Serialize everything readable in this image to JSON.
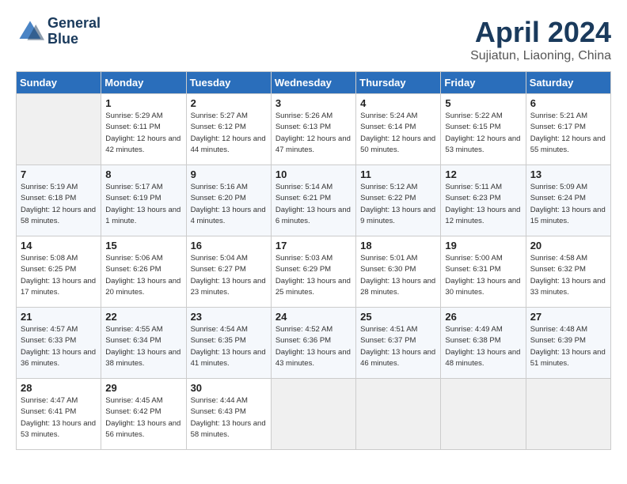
{
  "header": {
    "logo_line1": "General",
    "logo_line2": "Blue",
    "month_year": "April 2024",
    "location": "Sujiatun, Liaoning, China"
  },
  "weekdays": [
    "Sunday",
    "Monday",
    "Tuesday",
    "Wednesday",
    "Thursday",
    "Friday",
    "Saturday"
  ],
  "weeks": [
    [
      {
        "day": "",
        "sunrise": "",
        "sunset": "",
        "daylight": ""
      },
      {
        "day": "1",
        "sunrise": "5:29 AM",
        "sunset": "6:11 PM",
        "daylight": "12 hours and 42 minutes."
      },
      {
        "day": "2",
        "sunrise": "5:27 AM",
        "sunset": "6:12 PM",
        "daylight": "12 hours and 44 minutes."
      },
      {
        "day": "3",
        "sunrise": "5:26 AM",
        "sunset": "6:13 PM",
        "daylight": "12 hours and 47 minutes."
      },
      {
        "day": "4",
        "sunrise": "5:24 AM",
        "sunset": "6:14 PM",
        "daylight": "12 hours and 50 minutes."
      },
      {
        "day": "5",
        "sunrise": "5:22 AM",
        "sunset": "6:15 PM",
        "daylight": "12 hours and 53 minutes."
      },
      {
        "day": "6",
        "sunrise": "5:21 AM",
        "sunset": "6:17 PM",
        "daylight": "12 hours and 55 minutes."
      }
    ],
    [
      {
        "day": "7",
        "sunrise": "5:19 AM",
        "sunset": "6:18 PM",
        "daylight": "12 hours and 58 minutes."
      },
      {
        "day": "8",
        "sunrise": "5:17 AM",
        "sunset": "6:19 PM",
        "daylight": "13 hours and 1 minute."
      },
      {
        "day": "9",
        "sunrise": "5:16 AM",
        "sunset": "6:20 PM",
        "daylight": "13 hours and 4 minutes."
      },
      {
        "day": "10",
        "sunrise": "5:14 AM",
        "sunset": "6:21 PM",
        "daylight": "13 hours and 6 minutes."
      },
      {
        "day": "11",
        "sunrise": "5:12 AM",
        "sunset": "6:22 PM",
        "daylight": "13 hours and 9 minutes."
      },
      {
        "day": "12",
        "sunrise": "5:11 AM",
        "sunset": "6:23 PM",
        "daylight": "13 hours and 12 minutes."
      },
      {
        "day": "13",
        "sunrise": "5:09 AM",
        "sunset": "6:24 PM",
        "daylight": "13 hours and 15 minutes."
      }
    ],
    [
      {
        "day": "14",
        "sunrise": "5:08 AM",
        "sunset": "6:25 PM",
        "daylight": "13 hours and 17 minutes."
      },
      {
        "day": "15",
        "sunrise": "5:06 AM",
        "sunset": "6:26 PM",
        "daylight": "13 hours and 20 minutes."
      },
      {
        "day": "16",
        "sunrise": "5:04 AM",
        "sunset": "6:27 PM",
        "daylight": "13 hours and 23 minutes."
      },
      {
        "day": "17",
        "sunrise": "5:03 AM",
        "sunset": "6:29 PM",
        "daylight": "13 hours and 25 minutes."
      },
      {
        "day": "18",
        "sunrise": "5:01 AM",
        "sunset": "6:30 PM",
        "daylight": "13 hours and 28 minutes."
      },
      {
        "day": "19",
        "sunrise": "5:00 AM",
        "sunset": "6:31 PM",
        "daylight": "13 hours and 30 minutes."
      },
      {
        "day": "20",
        "sunrise": "4:58 AM",
        "sunset": "6:32 PM",
        "daylight": "13 hours and 33 minutes."
      }
    ],
    [
      {
        "day": "21",
        "sunrise": "4:57 AM",
        "sunset": "6:33 PM",
        "daylight": "13 hours and 36 minutes."
      },
      {
        "day": "22",
        "sunrise": "4:55 AM",
        "sunset": "6:34 PM",
        "daylight": "13 hours and 38 minutes."
      },
      {
        "day": "23",
        "sunrise": "4:54 AM",
        "sunset": "6:35 PM",
        "daylight": "13 hours and 41 minutes."
      },
      {
        "day": "24",
        "sunrise": "4:52 AM",
        "sunset": "6:36 PM",
        "daylight": "13 hours and 43 minutes."
      },
      {
        "day": "25",
        "sunrise": "4:51 AM",
        "sunset": "6:37 PM",
        "daylight": "13 hours and 46 minutes."
      },
      {
        "day": "26",
        "sunrise": "4:49 AM",
        "sunset": "6:38 PM",
        "daylight": "13 hours and 48 minutes."
      },
      {
        "day": "27",
        "sunrise": "4:48 AM",
        "sunset": "6:39 PM",
        "daylight": "13 hours and 51 minutes."
      }
    ],
    [
      {
        "day": "28",
        "sunrise": "4:47 AM",
        "sunset": "6:41 PM",
        "daylight": "13 hours and 53 minutes."
      },
      {
        "day": "29",
        "sunrise": "4:45 AM",
        "sunset": "6:42 PM",
        "daylight": "13 hours and 56 minutes."
      },
      {
        "day": "30",
        "sunrise": "4:44 AM",
        "sunset": "6:43 PM",
        "daylight": "13 hours and 58 minutes."
      },
      {
        "day": "",
        "sunrise": "",
        "sunset": "",
        "daylight": ""
      },
      {
        "day": "",
        "sunrise": "",
        "sunset": "",
        "daylight": ""
      },
      {
        "day": "",
        "sunrise": "",
        "sunset": "",
        "daylight": ""
      },
      {
        "day": "",
        "sunrise": "",
        "sunset": "",
        "daylight": ""
      }
    ]
  ]
}
